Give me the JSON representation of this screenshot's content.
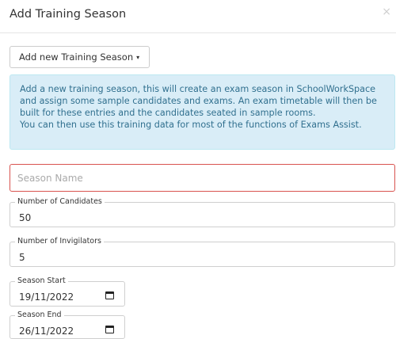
{
  "modal": {
    "title": "Add Training Season",
    "close_glyph": "×"
  },
  "dropdown": {
    "label": "Add new Training Season",
    "caret": "▾"
  },
  "alert": {
    "lines": [
      "Add a new training season, this will create an exam season in SchoolWorkSpace",
      "and assign some sample candidates and exams. An exam timetable will then be",
      "built for these entries and the candidates seated in sample rooms.",
      "You can then use this training data for most of the functions of Exams Assist."
    ],
    "color": "#31708f",
    "background": "#d9edf7"
  },
  "form": {
    "season_name": {
      "placeholder": "Season Name",
      "value": "",
      "error_color": "#d9534f"
    },
    "candidates": {
      "label": "Number of Candidates",
      "value": "50"
    },
    "invigilators": {
      "label": "Number of Invigilators",
      "value": "5"
    },
    "season_start": {
      "label": "Season Start",
      "value": "19/11/2022",
      "icon": "calendar-icon"
    },
    "season_end": {
      "label": "Season End",
      "value": "26/11/2022",
      "icon": "calendar-icon"
    }
  }
}
